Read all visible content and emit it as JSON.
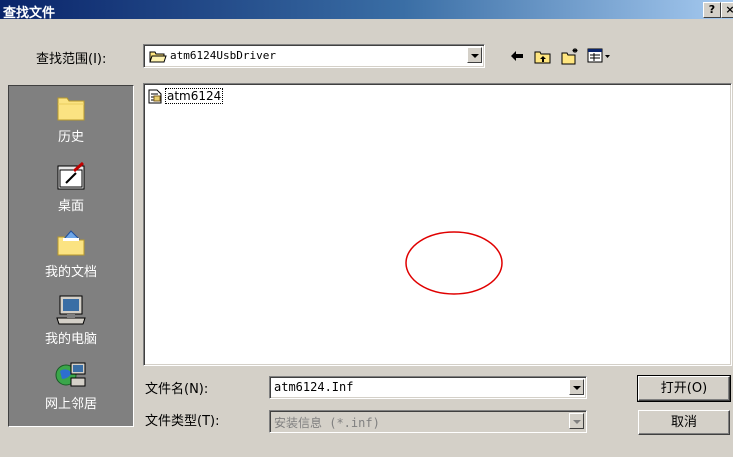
{
  "window": {
    "title": "查找文件",
    "help_label": "?",
    "close_label": "×"
  },
  "lookin": {
    "label": "查找范围(I):",
    "value": "atm6124UsbDriver"
  },
  "toolbar": {
    "back_icon": "back-arrow-icon",
    "up_icon": "up-folder-icon",
    "newfolder_icon": "new-folder-icon",
    "view_icon": "view-menu-icon"
  },
  "places": {
    "items": [
      {
        "label": "历史",
        "icon": "history-icon"
      },
      {
        "label": "桌面",
        "icon": "desktop-icon"
      },
      {
        "label": "我的文档",
        "icon": "my-documents-icon"
      },
      {
        "label": "我的电脑",
        "icon": "my-computer-icon"
      },
      {
        "label": "网上邻居",
        "icon": "network-icon"
      }
    ]
  },
  "files": [
    {
      "name": "atm6124",
      "icon": "inf-file-icon"
    }
  ],
  "filename": {
    "label": "文件名(N):",
    "value": "atm6124.Inf"
  },
  "filetype": {
    "label": "文件类型(T):",
    "value": "安装信息 (*.inf)"
  },
  "buttons": {
    "open": "打开(O)",
    "cancel": "取消"
  },
  "colors": {
    "title_bar": "#0a246a",
    "dialog_bg": "#d4d0c8",
    "places_bg": "#808080",
    "annotation": "#e00000"
  }
}
